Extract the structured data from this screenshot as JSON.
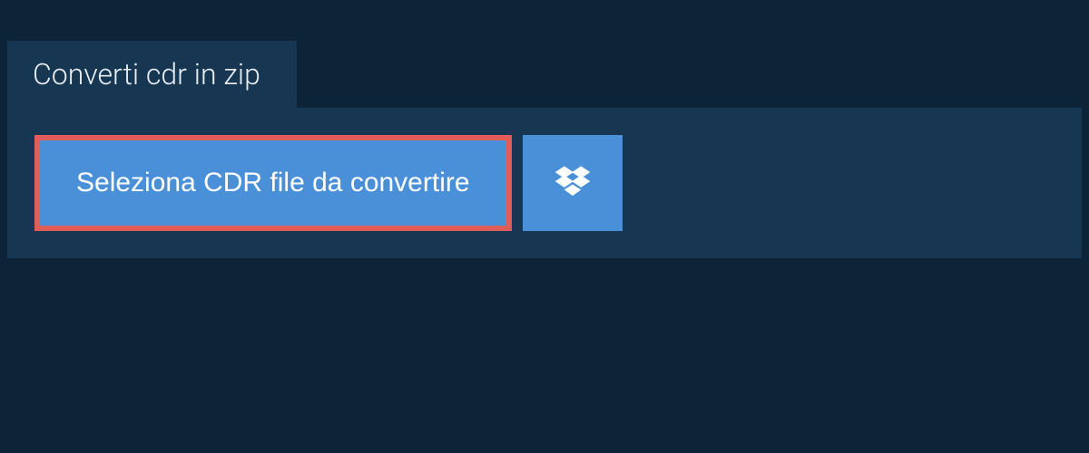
{
  "tab": {
    "title": "Converti cdr in zip"
  },
  "actions": {
    "select_file_label": "Seleziona CDR file da convertire"
  }
}
